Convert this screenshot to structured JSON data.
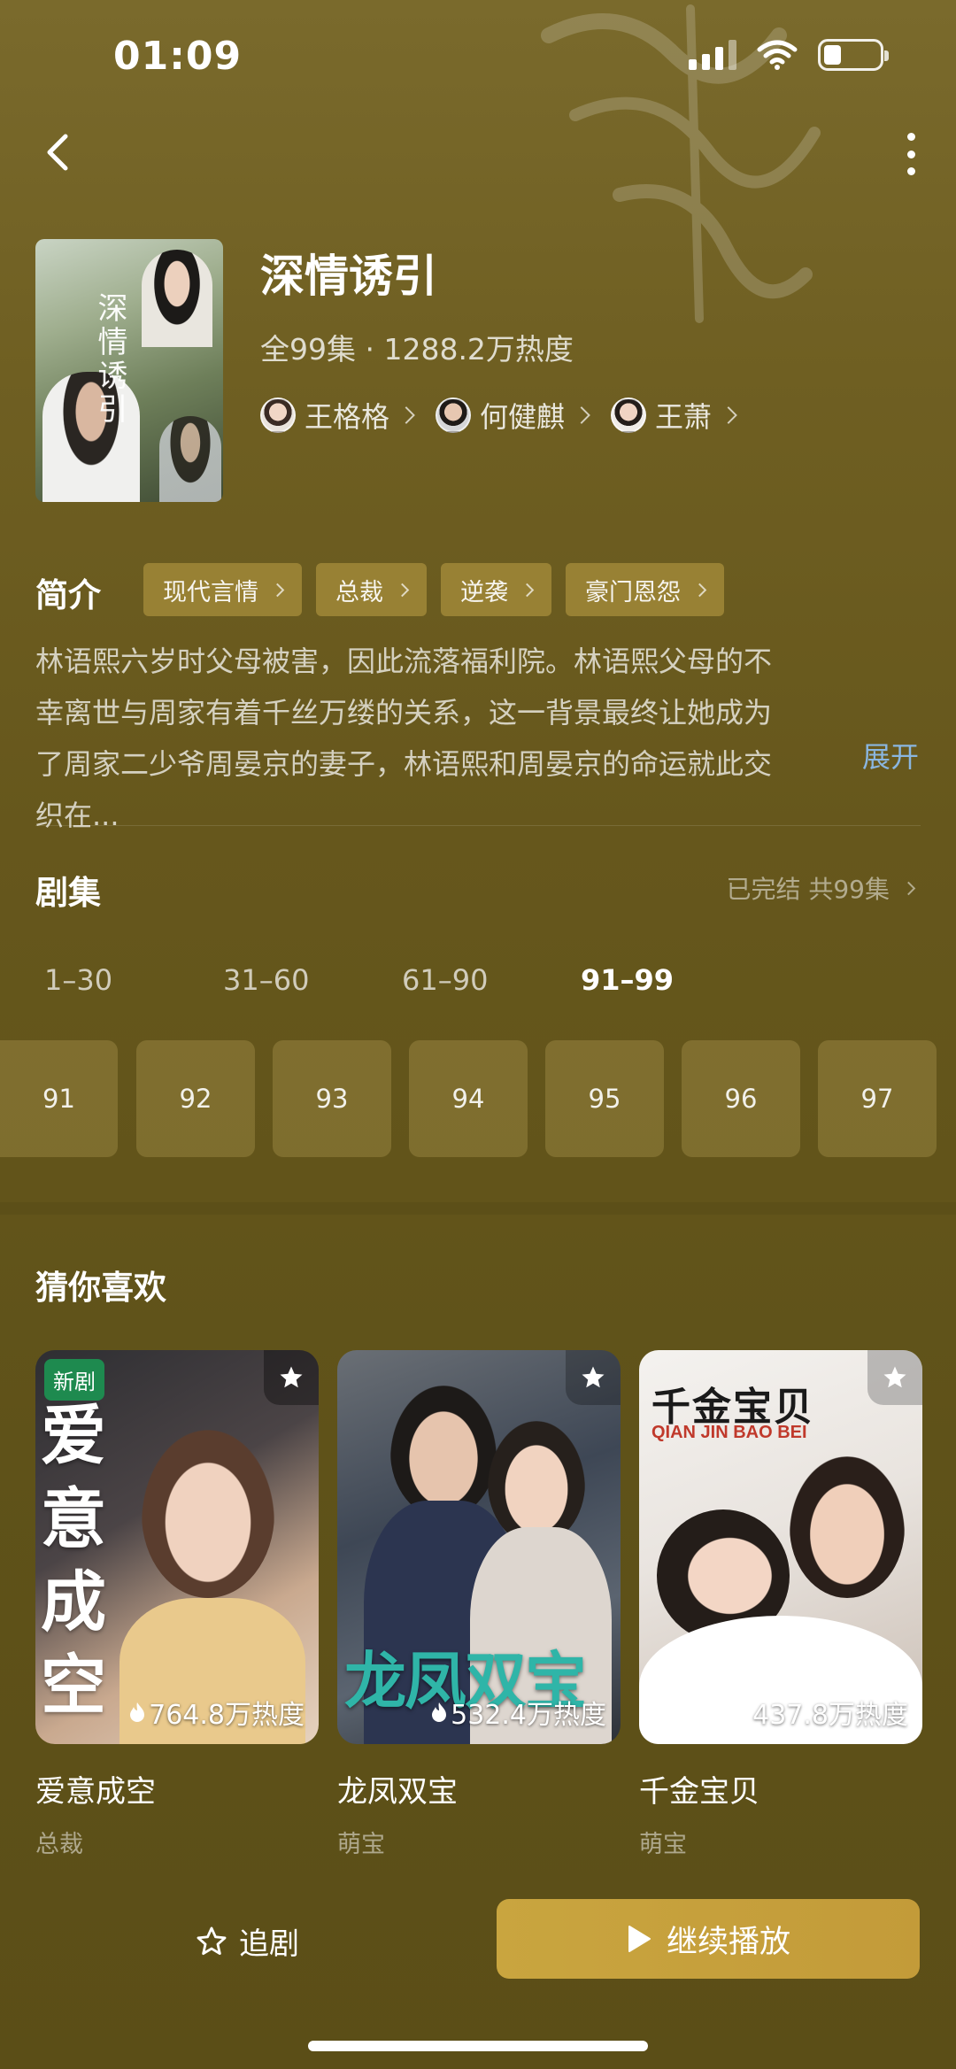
{
  "status_bar": {
    "time": "01:09"
  },
  "drama": {
    "title": "深情诱引",
    "meta": "全99集 · 1288.2万热度",
    "poster_art_text": "深情诱引",
    "cast": [
      {
        "name": "王格格"
      },
      {
        "name": "何健麒"
      },
      {
        "name": "王萧"
      }
    ]
  },
  "intro": {
    "heading": "简介",
    "tags": [
      "现代言情",
      "总裁",
      "逆袭",
      "豪门恩怨"
    ],
    "text": "林语熙六岁时父母被害，因此流落福利院。林语熙父母的不幸离世与周家有着千丝万缕的关系，这一背景最终让她成为了周家二少爷周晏京的妻子，林语熙和周晏京的命运就此交织在...",
    "expand_label": "展开"
  },
  "episodes": {
    "heading": "剧集",
    "status": "已完结 共99集",
    "ranges": [
      "1–30",
      "31–60",
      "61–90",
      "91–99"
    ],
    "active_range_index": 3,
    "tiles": [
      "91",
      "92",
      "93",
      "94",
      "95",
      "96",
      "97"
    ]
  },
  "recommend": {
    "heading": "猜你喜欢",
    "items": [
      {
        "title": "爱意成空",
        "genre": "总裁",
        "heat": "764.8万热度",
        "badge": "新剧",
        "cover_text": "爱意成空"
      },
      {
        "title": "龙凤双宝",
        "genre": "萌宝",
        "heat": "532.4万热度",
        "cover_text": "龙凤双宝"
      },
      {
        "title": "千金宝贝",
        "genre": "萌宝",
        "heat": "437.8万热度",
        "cover_text": "千金宝贝",
        "cover_subtext": "QIAN JIN BAO BEI"
      }
    ]
  },
  "bottom_bar": {
    "follow_label": "追剧",
    "play_label": "继续播放"
  },
  "colors": {
    "background": "#6f5f22",
    "tag_bg": "#a98c3e",
    "play_button": "#c9a53f",
    "expand_link": "#8ab6e0",
    "new_badge": "#1e8a4f"
  }
}
